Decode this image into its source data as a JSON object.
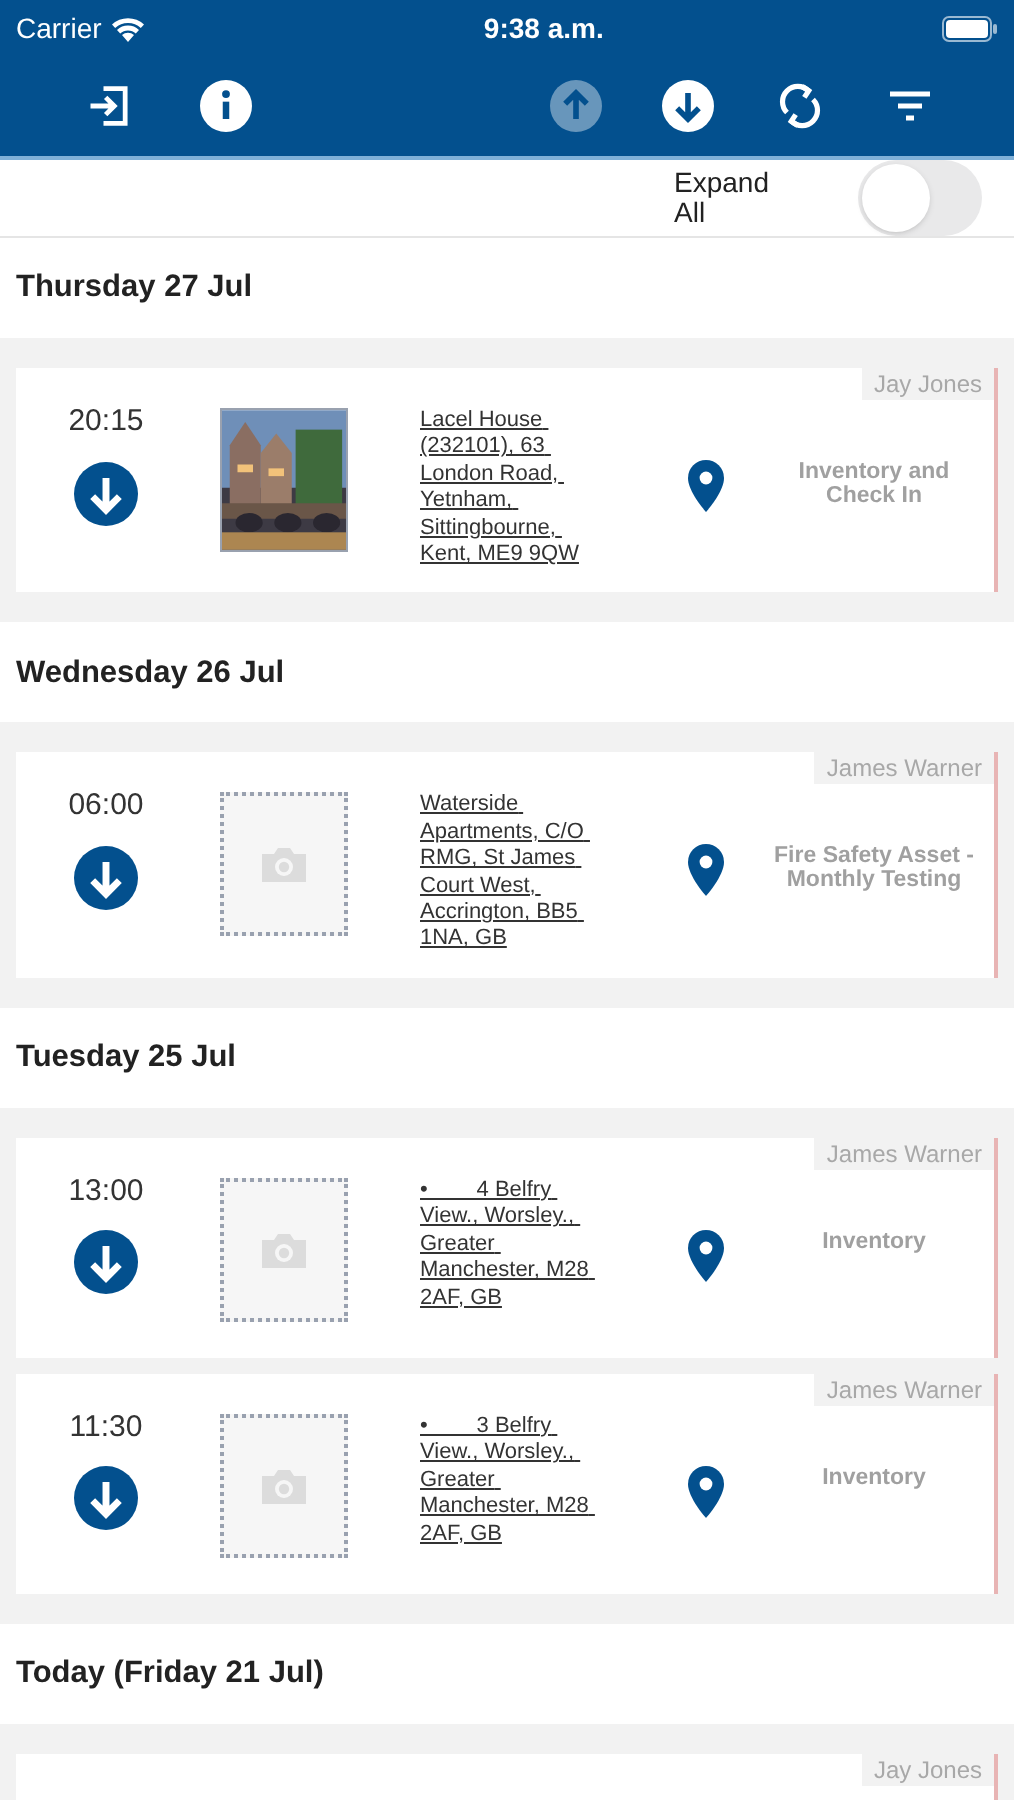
{
  "status_bar": {
    "carrier": "Carrier",
    "time": "9:38 a.m."
  },
  "toolbar": [
    {
      "kind": "exit",
      "disabled": false
    },
    {
      "kind": "info",
      "disabled": false
    },
    {
      "kind": "upload",
      "disabled": true
    },
    {
      "kind": "download",
      "disabled": false
    },
    {
      "kind": "sync",
      "disabled": false
    },
    {
      "kind": "filter",
      "disabled": false
    }
  ],
  "expand_all": {
    "label": "Expand All",
    "on": false
  },
  "days": [
    {
      "heading": "Thursday 27 Jul",
      "jobs": [
        {
          "assignee": "Jay Jones",
          "time": "20:15",
          "address": "Lacel House (232101), 63 London Road, Yetnham, Sittingbourne, Kent, ME9 9QW",
          "type": "Inventory and Check In"
        }
      ]
    },
    {
      "heading": "Wednesday 26 Jul",
      "jobs": [
        {
          "assignee": "James Warner",
          "time": "06:00",
          "kind": "placeholder",
          "address": "Waterside Apartments, C/O RMG, St James Court West, Accrington, BB5 1NA, GB",
          "type": "Fire Safety Asset - Monthly Testing"
        }
      ]
    },
    {
      "heading": "Tuesday 25 Jul",
      "jobs": [
        {
          "assignee": "James Warner",
          "time": "13:00",
          "kind": "placeholder",
          "address": "•        4 Belfry View., Worsley., Greater Manchester, M28 2AF, GB",
          "type": "Inventory"
        },
        {
          "assignee": "James Warner",
          "time": "11:30",
          "kind": "placeholder",
          "address": "•        3 Belfry View., Worsley., Greater Manchester, M28 2AF, GB",
          "type": "Inventory"
        }
      ]
    },
    {
      "heading": "Today (Friday 21 Jul)",
      "jobs": [
        {
          "assignee": "Jay Jones"
        }
      ]
    }
  ]
}
